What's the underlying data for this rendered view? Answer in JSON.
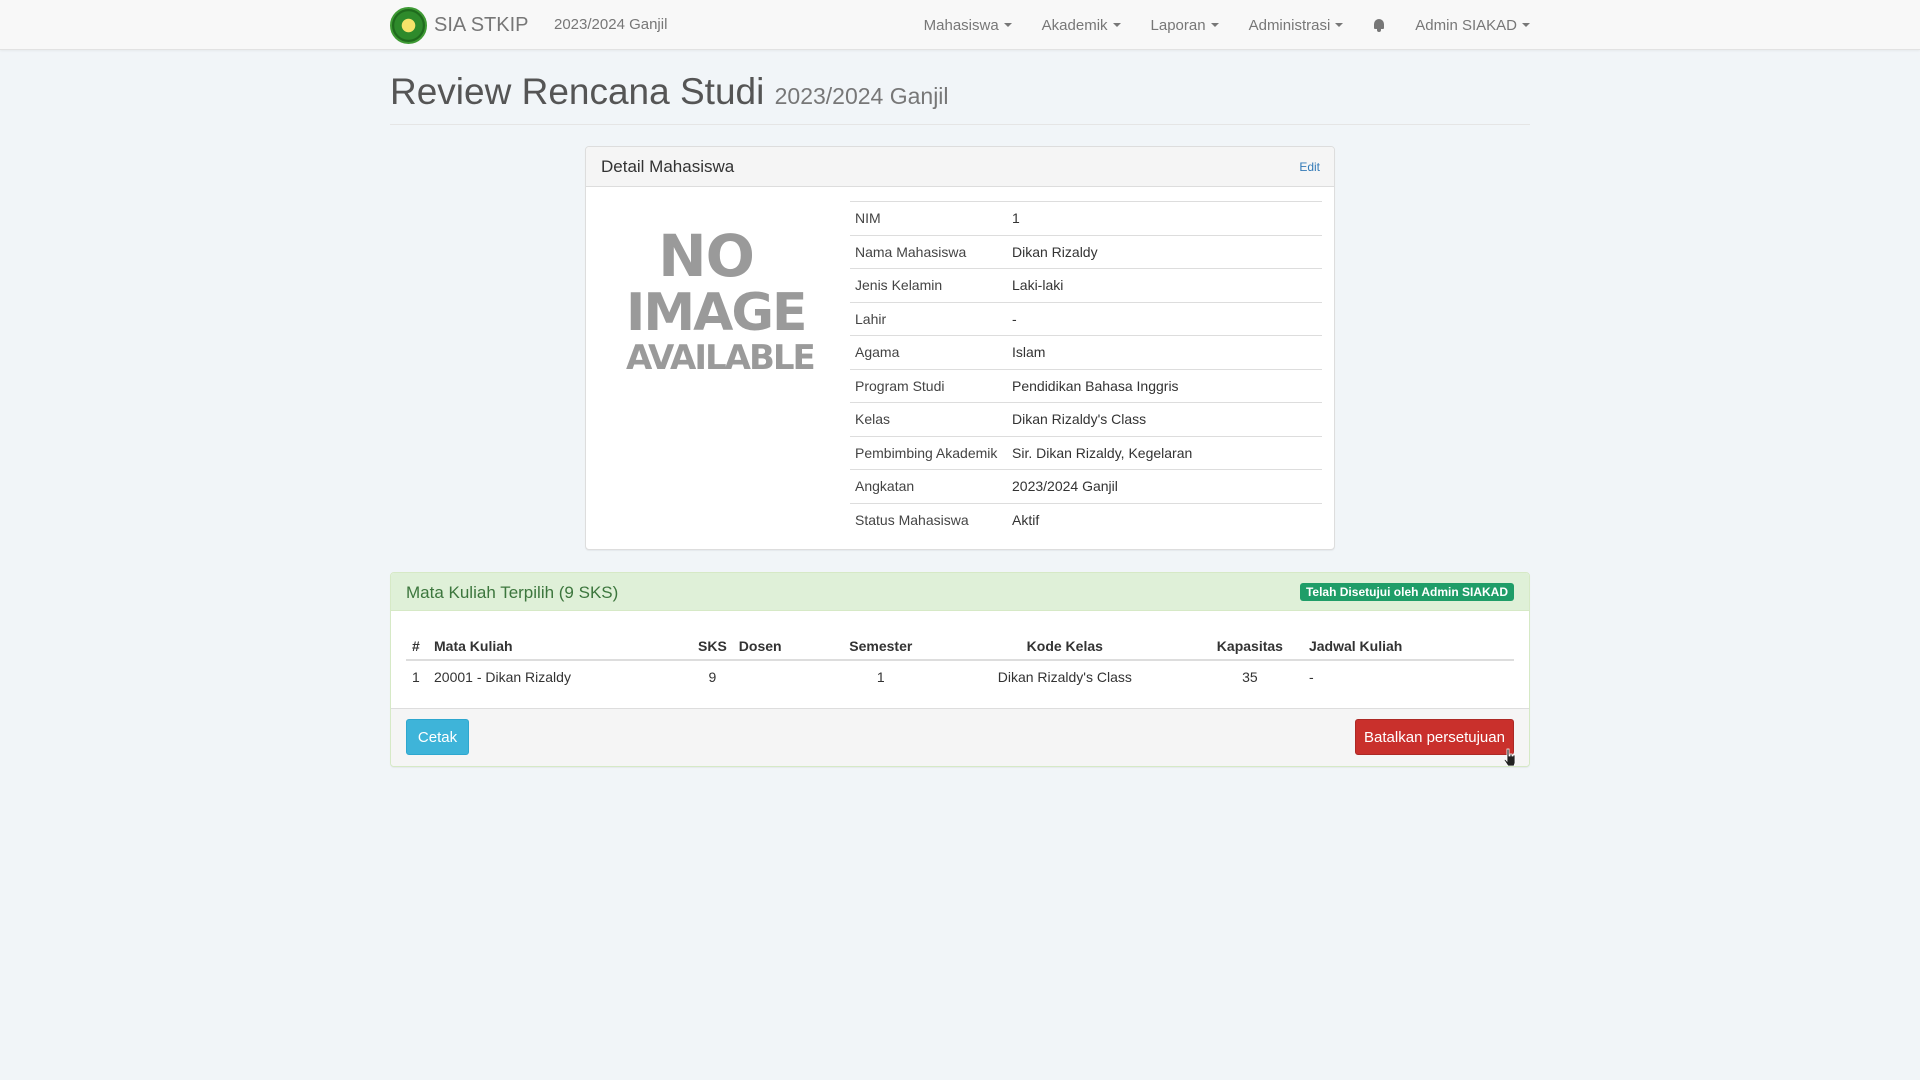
{
  "navbar": {
    "brand": "SIA STKIP",
    "term": "2023/2024 Ganjil",
    "menus": [
      "Mahasiswa",
      "Akademik",
      "Laporan",
      "Administrasi"
    ],
    "bell_icon": "bell-icon",
    "user": "Admin SIAKAD"
  },
  "page": {
    "title": "Review Rencana Studi",
    "subtitle": "2023/2024 Ganjil"
  },
  "detail": {
    "title": "Detail Mahasiswa",
    "edit_label": "Edit",
    "noimage": [
      "NO",
      "IMAGE",
      "AVAILABLE"
    ],
    "rows": [
      {
        "label": "NIM",
        "value": "1"
      },
      {
        "label": "Nama Mahasiswa",
        "value": "Dikan Rizaldy"
      },
      {
        "label": "Jenis Kelamin",
        "value": "Laki-laki"
      },
      {
        "label": "Lahir",
        "value": "-"
      },
      {
        "label": "Agama",
        "value": "Islam"
      },
      {
        "label": "Program Studi",
        "value": "Pendidikan Bahasa Inggris"
      },
      {
        "label": "Kelas",
        "value": "Dikan Rizaldy's Class"
      },
      {
        "label": "Pembimbing Akademik",
        "value": "Sir. Dikan Rizaldy, Kegelaran"
      },
      {
        "label": "Angkatan",
        "value": "2023/2024 Ganjil"
      },
      {
        "label": "Status Mahasiswa",
        "value": "Aktif"
      }
    ]
  },
  "courses": {
    "title": "Mata Kuliah Terpilih (9 SKS)",
    "status_badge": "Telah Disetujui oleh Admin SIAKAD",
    "headers": [
      "#",
      "Mata Kuliah",
      "SKS",
      "Dosen",
      "Semester",
      "Kode Kelas",
      "Kapasitas",
      "Jadwal Kuliah"
    ],
    "rows": [
      [
        "1",
        "20001 - Dikan Rizaldy",
        "9",
        "",
        "1",
        "Dikan Rizaldy's Class",
        "35",
        "-"
      ]
    ],
    "print_label": "Cetak",
    "cancel_label": "Batalkan persetujuan"
  },
  "colors": {
    "approved_badge": "#1f9d68",
    "cancel_button": "#c9302c",
    "print_button": "#3eb4d9"
  }
}
